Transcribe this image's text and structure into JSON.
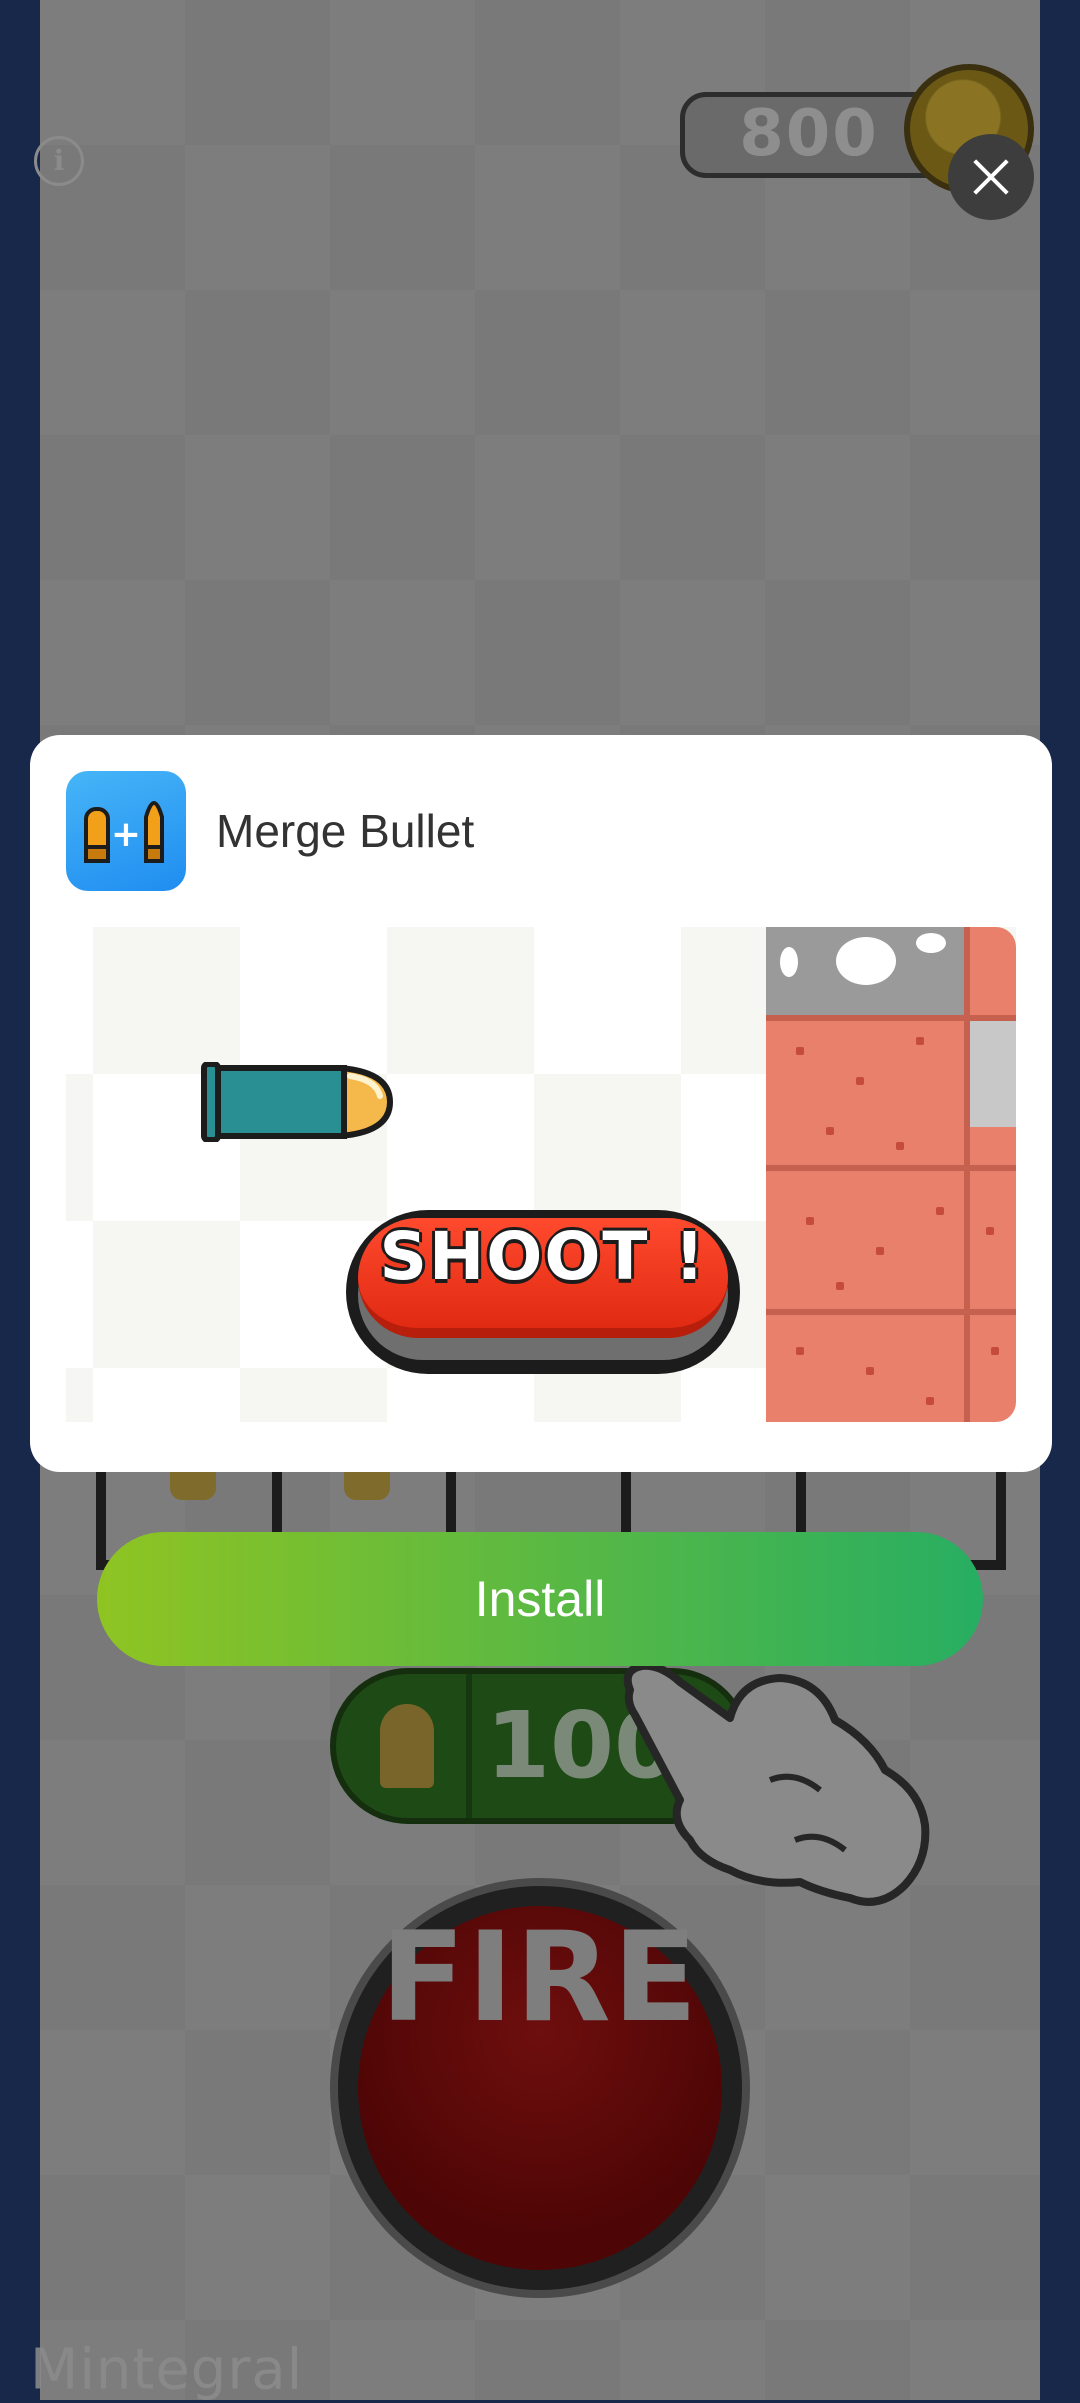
{
  "game": {
    "coins": "800",
    "ammo_count": "100",
    "fire_label": "FIRE",
    "watermark": "Mintegral",
    "icons": [
      "info-icon",
      "coin-icon",
      "bullet-icon",
      "hand-pointer-icon"
    ]
  },
  "ad": {
    "app_name": "Merge Bullet",
    "app_icon": "merge-bullet-app-icon",
    "preview": {
      "shoot_label": "SHOOT !"
    },
    "install_label": "Install",
    "close_icon": "close-icon"
  },
  "colors": {
    "install_gradient_start": "#8fc422",
    "install_gradient_end": "#27ae62",
    "shoot_red": "#ff4a2e",
    "frame_navy": "#18284a"
  }
}
